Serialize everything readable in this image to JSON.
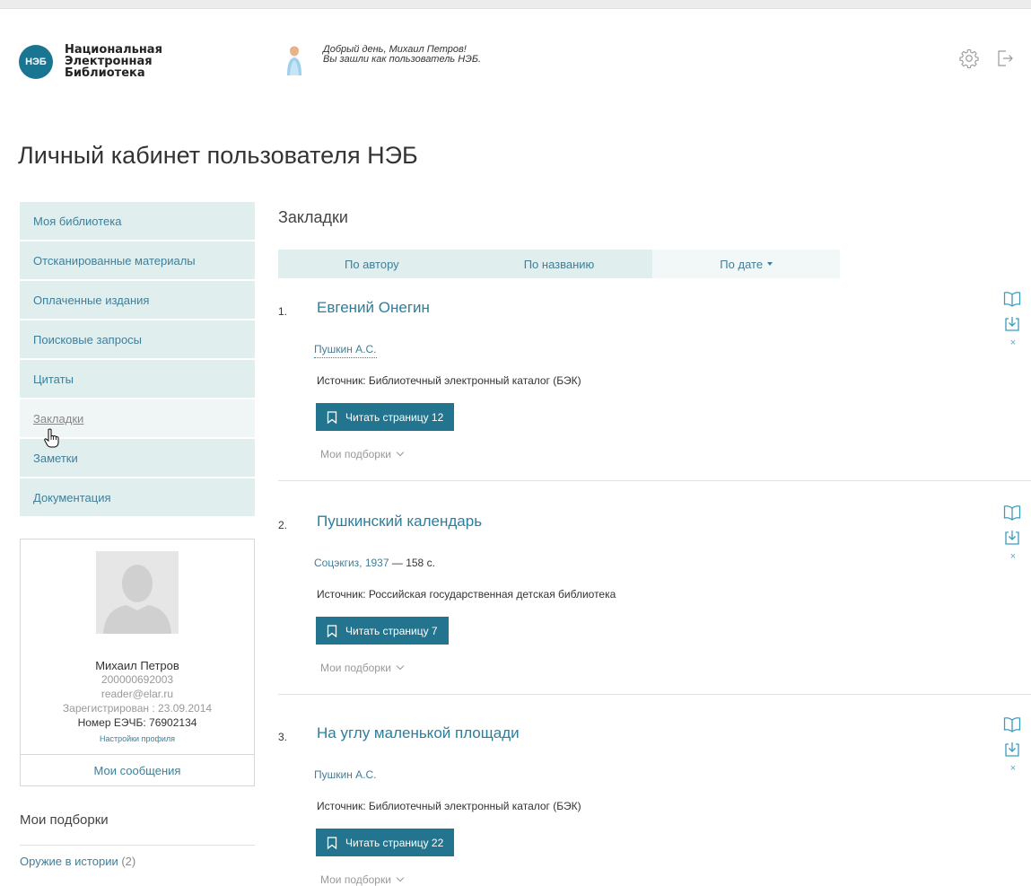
{
  "header": {
    "logo_badge": "НЭБ",
    "logo_lines": [
      "Национальная",
      "Электронная",
      "Библиотека"
    ],
    "greeting_line1": "Добрый день, Михаил Петров!",
    "greeting_line2": "Вы зашли как пользователь НЭБ.",
    "icons": [
      "gear-icon",
      "logout-icon"
    ]
  },
  "page_title": "Личный кабинет пользователя НЭБ",
  "sidebar": {
    "items": [
      {
        "label": "Моя библиотека"
      },
      {
        "label": "Отсканированные материалы"
      },
      {
        "label": "Оплаченные издания"
      },
      {
        "label": "Поисковые запросы"
      },
      {
        "label": "Цитаты"
      },
      {
        "label": "Закладки",
        "active": true
      },
      {
        "label": "Заметки"
      },
      {
        "label": "Документация"
      }
    ]
  },
  "profile": {
    "name": "Михаил Петров",
    "id": "200000692003",
    "email": "reader@elar.ru",
    "registered": "Зарегистрирован : 23.09.2014",
    "card": "Номер ЕЭЧБ: 76902134",
    "settings_link": "Настройки профиля",
    "messages_link": "Мои сообщения"
  },
  "collections": {
    "title": "Мои подборки",
    "items": [
      {
        "label": "Оружие в истории",
        "count": "(2)"
      }
    ]
  },
  "main": {
    "section_title": "Закладки",
    "sort": {
      "by_author": "По автору",
      "by_title": "По названию",
      "by_date": "По дате"
    },
    "bookmarks": [
      {
        "num": "1.",
        "title": "Евгений Онегин",
        "author": "Пушкин А.С.",
        "source": "Источник: Библиотечный электронный каталог (БЭК)",
        "button": "Читать страницу 12",
        "selections": "Мои подборки"
      },
      {
        "num": "2.",
        "title": "Пушкинский календарь",
        "author": "Соцэкгиз, 1937",
        "pages": "— 158 с.",
        "source": "Источник: Российская государственная детская библиотека",
        "button": "Читать страницу 7",
        "selections": "Мои подборки"
      },
      {
        "num": "3.",
        "title": "На углу маленькой площади",
        "author": "Пушкин А.С.",
        "source": "Источник: Библиотечный электронный каталог (БЭК)",
        "button": "Читать страницу 22",
        "selections": "Мои подборки"
      }
    ],
    "remove_glyph": "×"
  }
}
